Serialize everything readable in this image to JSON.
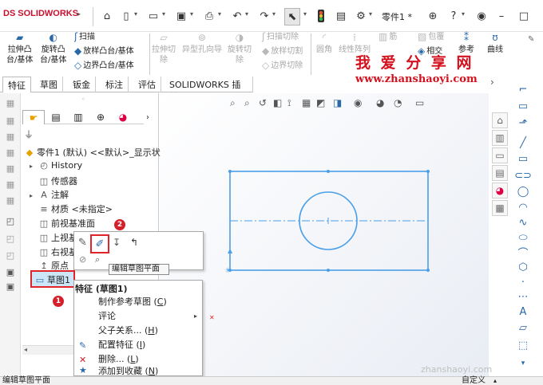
{
  "titlebar": {
    "brand": "SOLIDWORKS",
    "brand_mark": "DS",
    "part_name": "零件1 *"
  },
  "ribbon": {
    "extrude_boss": "拉伸凸\n台/基体",
    "revolve_boss": "旋转凸\n台/基体",
    "sweep": "扫描",
    "loft_boss": "放样凸台/基体",
    "boundary_boss": "边界凸台/基体",
    "extrude_cut": "拉伸切\n除",
    "hole_wizard": "异型孔向导",
    "revolve_cut": "旋转切\n除",
    "swept_cut": "扫描切除",
    "lofted_cut": "放样切割",
    "boundary_cut": "边界切除",
    "fillet": "圆角",
    "linear_pattern": "线性阵列",
    "rib": "筋",
    "wrap": "包覆",
    "intersect": "相交",
    "ref_geometry": "参考",
    "curves": "曲线"
  },
  "tabs": [
    "特征",
    "草图",
    "钣金",
    "标注",
    "评估",
    "SOLIDWORKS 插件"
  ],
  "tree": {
    "root": "零件1 (默认) <<默认>_显示状",
    "items": [
      "History",
      "传感器",
      "注解",
      "材质 <未指定>",
      "前视基准面",
      "上视基",
      "右视基",
      "原点",
      "草图1"
    ]
  },
  "mini_toolbar": {
    "tooltip": "编辑草图平面"
  },
  "context_menu": {
    "title": "特征 (草图1)",
    "items": [
      {
        "label": "制作参考草图 (",
        "key": "C",
        "end": ")"
      },
      {
        "label": "评论",
        "key": "",
        "end": ""
      },
      {
        "label": "父子关系... (",
        "key": "H",
        "end": ")"
      },
      {
        "label": "配置特征 (",
        "key": "I",
        "end": ")"
      },
      {
        "label": "删除... (",
        "key": "L",
        "end": ")"
      },
      {
        "label": "添加到收藏 (",
        "key": "N",
        "end": ")"
      }
    ]
  },
  "badges": {
    "one": "1",
    "two": "2"
  },
  "watermark": {
    "cn": "我 爱 分 享 网",
    "url": "www.zhanshaoyi.com",
    "url2": "zhanshaoyi.com"
  },
  "status": {
    "left": "编辑草图平面",
    "right": "自定义"
  },
  "colors": {
    "sketch": "#4a9fe8",
    "accent": "#d3202a",
    "brand": "#c8102e"
  }
}
